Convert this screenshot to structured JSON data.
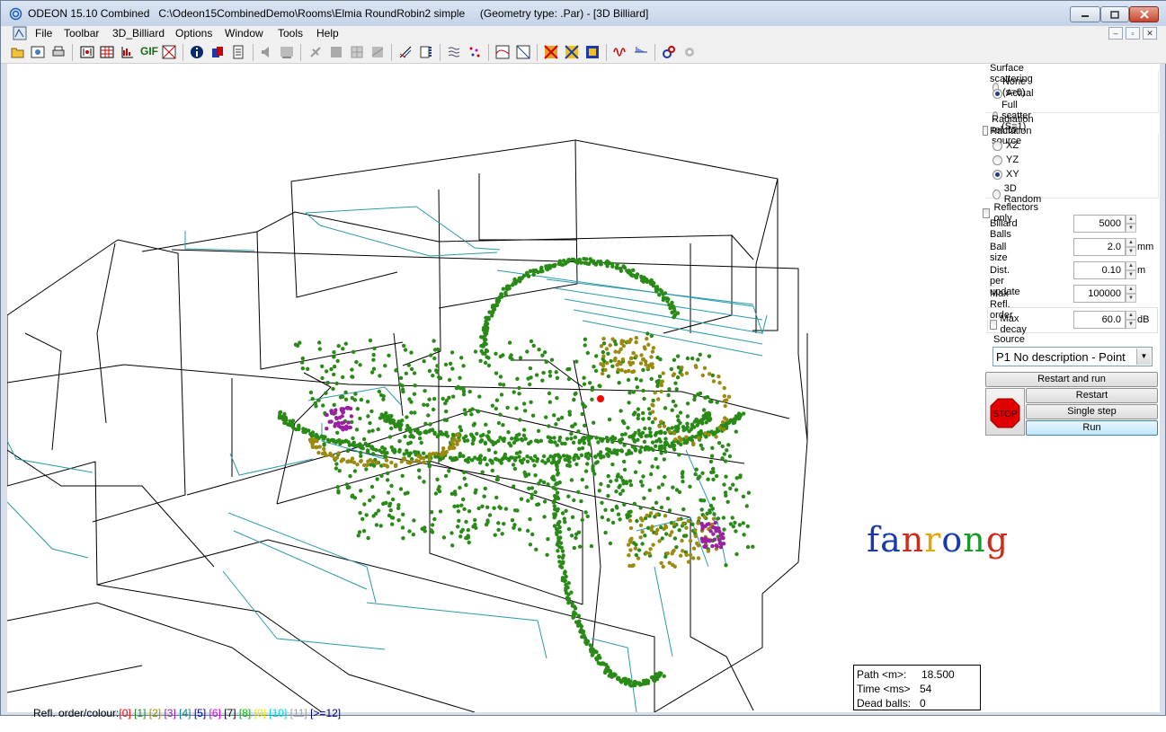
{
  "window": {
    "title": "ODEON 15.10 Combined   C:\\Odeon15CombinedDemo\\Rooms\\Elmia RoundRobin2 simple     (Geometry type: .Par) - [3D Billiard]"
  },
  "menu": [
    "File",
    "Toolbar",
    "3D_Billiard",
    "Options",
    "Window",
    "Tools",
    "Help"
  ],
  "panel": {
    "surface_scattering": {
      "label": "Surface scattering",
      "options": [
        "None (s=0)",
        "Actual",
        "Full scatter (S=1)"
      ],
      "selected": "Actual"
    },
    "radiation_rel_to_source": {
      "label": "Radiation rel. to source",
      "checked": false
    },
    "radiation": {
      "label": "Radiation",
      "options": [
        "XZ",
        "YZ",
        "XY",
        "3D Random"
      ],
      "selected": "XY"
    },
    "reflectors_only": {
      "label": "Reflectors only",
      "checked": false
    },
    "billiard_balls": {
      "label": "Billard Balls",
      "value": "5000"
    },
    "ball_size": {
      "label": "Ball size",
      "value": "2.0",
      "unit": "mm"
    },
    "dist_per_update": {
      "label": "Dist. per update",
      "value": "0.10",
      "unit": "m"
    },
    "max_refl_order": {
      "label": "Max Refl. order",
      "value": "100000"
    },
    "max_decay": {
      "label": "Max decay",
      "value": "60.0",
      "unit": "dB",
      "checked": false
    },
    "source": {
      "label": "Source",
      "value": "P1 No description  -  Point"
    },
    "buttons": {
      "restart_and_run": "Restart and run",
      "stop": "STOP",
      "restart": "Restart",
      "single_step": "Single step",
      "run": "Run"
    }
  },
  "info": {
    "path_label": "Path <m>:",
    "path_value": "18.500",
    "time_label": "Time <ms>",
    "time_value": "54",
    "dead_label": "Dead balls:",
    "dead_value": "0"
  },
  "legend": {
    "label": "Refl. order/colour:",
    "entries": [
      {
        "text": "[0]",
        "color": "#ff0000"
      },
      {
        "text": "[1]",
        "color": "#1e8c1e"
      },
      {
        "text": "[2]",
        "color": "#9a8f00"
      },
      {
        "text": "[3]",
        "color": "#a020a0"
      },
      {
        "text": "[4]",
        "color": "#0a8a8a"
      },
      {
        "text": "[5]",
        "color": "#0000b0"
      },
      {
        "text": "[6]",
        "color": "#e000e0"
      },
      {
        "text": "[7]",
        "color": "#000000"
      },
      {
        "text": "[8]",
        "color": "#00c000"
      },
      {
        "text": "[9]",
        "color": "#e6e600"
      },
      {
        "text": "[10]",
        "color": "#00d8d8"
      },
      {
        "text": "[11]",
        "color": "#a0a0a0"
      },
      {
        "text": "[>=12]",
        "color": "#000080"
      }
    ]
  },
  "watermark": {
    "letters": [
      {
        "ch": "f",
        "color": "#1a3aa8"
      },
      {
        "ch": "a",
        "color": "#1a3aa8"
      },
      {
        "ch": "n",
        "color": "#d02a1a"
      },
      {
        "ch": "r",
        "color": "#e0a800"
      },
      {
        "ch": "o",
        "color": "#1a3aa8"
      },
      {
        "ch": "n",
        "color": "#1a9a2a"
      },
      {
        "ch": "g",
        "color": "#d02a1a"
      }
    ]
  },
  "colors": {
    "wire": "#000000",
    "wire_teal": "#2a9aa8",
    "ball_green": "#2a8a18",
    "ball_olive": "#9a8a10",
    "ball_purple": "#9a20a0",
    "source": "#ff0000"
  }
}
